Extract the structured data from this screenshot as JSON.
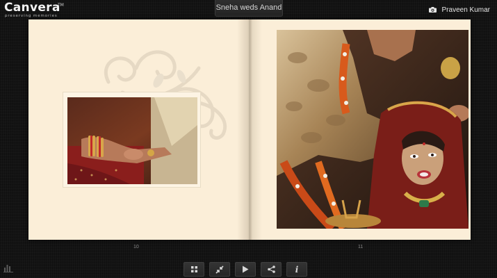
{
  "header": {
    "logo_text": "Canvera",
    "logo_trademark": "TM",
    "logo_tagline": "preserving memories",
    "album_title": "Sneha weds Anand",
    "user_icon": "camera-icon",
    "user_name": "Praveen Kumar"
  },
  "album": {
    "left_page": {
      "number": "10",
      "photo": "bride-hands-with-bangles-photo",
      "ornament": "floral-swirl"
    },
    "right_page": {
      "number": "11",
      "photo": "bride-veil-ceremony-photo"
    }
  },
  "toolbar": {
    "buttons": [
      {
        "icon": "grid-icon",
        "action": "thumbnails"
      },
      {
        "icon": "collapse-arrows-icon",
        "action": "exit-fullscreen"
      },
      {
        "icon": "play-icon",
        "action": "slideshow"
      },
      {
        "icon": "share-icon",
        "action": "share"
      },
      {
        "icon": "info-icon",
        "label": "i",
        "action": "info"
      }
    ]
  },
  "footer": {
    "stats_icon": "stats-icon"
  },
  "colors": {
    "background": "#141414",
    "page": "#fbeed8",
    "toolbar_button": "#2c2c2c"
  }
}
